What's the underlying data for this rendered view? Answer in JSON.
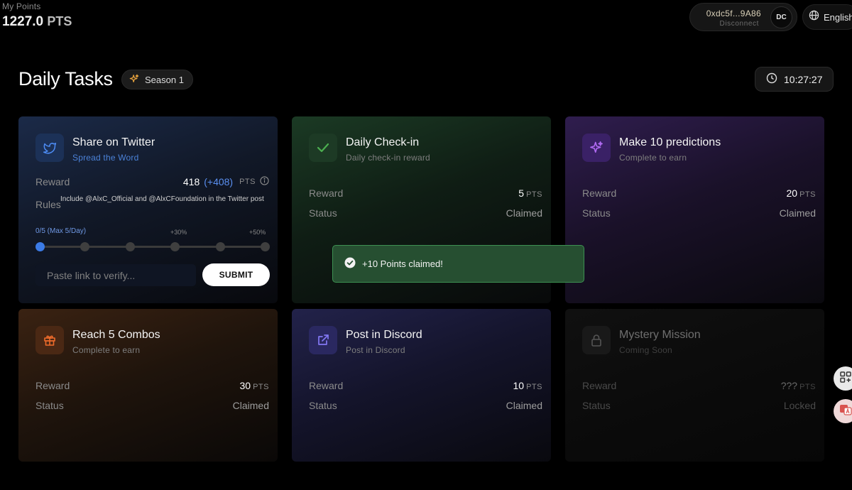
{
  "header": {
    "points_label": "My Points",
    "points_value": "1227.0",
    "points_unit": "PTS",
    "wallet_address": "0xdc5f...9A86",
    "disconnect_label": "Disconnect",
    "avatar_initials": "DC",
    "language": "English"
  },
  "page": {
    "title": "Daily Tasks",
    "season_label": "Season 1",
    "timer": "10:27:27"
  },
  "tasks": {
    "twitter": {
      "title": "Share on Twitter",
      "subtitle": "Spread the Word",
      "reward_label": "Reward",
      "reward_value": "418",
      "reward_bonus": "(+408)",
      "unit": "PTS",
      "rules_label": "Rules",
      "rules_text": "Include @AlxC_Official and @AlxCFoundation in the Twitter post",
      "progress_label": "0/5 (Max 5/Day)",
      "progress_fraction": 0,
      "mark_30": "+30%",
      "mark_50": "+50%",
      "input_placeholder": "Paste link to verify...",
      "submit_label": "SUBMIT"
    },
    "checkin": {
      "title": "Daily Check-in",
      "subtitle": "Daily check-in reward",
      "reward_label": "Reward",
      "reward_value": "5",
      "unit": "PTS",
      "status_label": "Status",
      "status_value": "Claimed"
    },
    "predictions": {
      "title": "Make 10 predictions",
      "subtitle": "Complete to earn",
      "reward_label": "Reward",
      "reward_value": "20",
      "unit": "PTS",
      "status_label": "Status",
      "status_value": "Claimed"
    },
    "combos": {
      "title": "Reach 5 Combos",
      "subtitle": "Complete to earn",
      "reward_label": "Reward",
      "reward_value": "30",
      "unit": "PTS",
      "status_label": "Status",
      "status_value": "Claimed"
    },
    "discord": {
      "title": "Post in Discord",
      "subtitle": "Post in Discord",
      "reward_label": "Reward",
      "reward_value": "10",
      "unit": "PTS",
      "status_label": "Status",
      "status_value": "Claimed"
    },
    "mystery": {
      "title": "Mystery Mission",
      "subtitle": "Coming Soon",
      "reward_label": "Reward",
      "reward_value": "???",
      "unit": "PTS",
      "status_label": "Status",
      "status_value": "Locked"
    }
  },
  "toast": {
    "message": "+10 Points claimed!"
  },
  "icons": {
    "twitter": "twitter-icon",
    "checkin": "check-icon",
    "predictions": "sparkle-icon",
    "combos": "gift-icon",
    "discord": "external-link-icon",
    "mystery": "lock-icon",
    "season": "sparkle-icon",
    "timer": "clock-icon",
    "language": "globe-icon"
  },
  "colors": {
    "accent_blue": "#3b7be6",
    "success_green": "#3d9152",
    "checkin_green": "#4caf50",
    "predict_purple": "#a35be8",
    "combo_orange": "#e8682a",
    "discord_indigo": "#7b6ef0"
  }
}
